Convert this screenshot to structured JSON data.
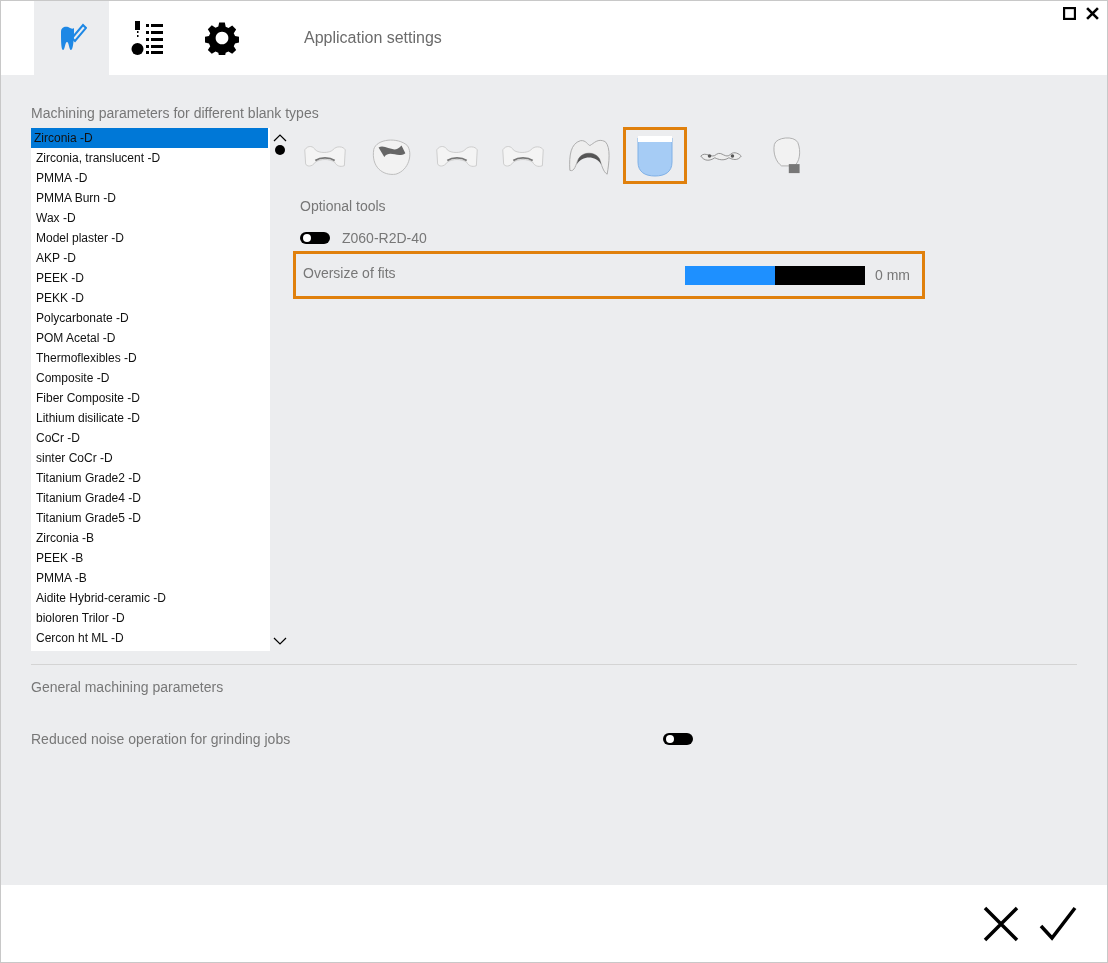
{
  "header": {
    "tabs": [
      {
        "kind": "tooth",
        "selected": true
      },
      {
        "kind": "toolpath",
        "selected": false
      },
      {
        "kind": "gear",
        "selected": false
      }
    ],
    "title": "Application settings"
  },
  "blank_section": {
    "heading": "Machining parameters for different blank types",
    "blank_types": [
      {
        "label": "Zirconia -D",
        "selected": true
      },
      {
        "label": "Zirconia, translucent -D",
        "selected": false
      },
      {
        "label": "PMMA -D",
        "selected": false
      },
      {
        "label": "PMMA Burn -D",
        "selected": false
      },
      {
        "label": "Wax -D",
        "selected": false
      },
      {
        "label": "Model plaster -D",
        "selected": false
      },
      {
        "label": "AKP -D",
        "selected": false
      },
      {
        "label": "PEEK -D",
        "selected": false
      },
      {
        "label": "PEKK -D",
        "selected": false
      },
      {
        "label": "Polycarbonate -D",
        "selected": false
      },
      {
        "label": "POM Acetal -D",
        "selected": false
      },
      {
        "label": "Thermoflexibles -D",
        "selected": false
      },
      {
        "label": "Composite -D",
        "selected": false
      },
      {
        "label": "Fiber Composite -D",
        "selected": false
      },
      {
        "label": "Lithium disilicate -D",
        "selected": false
      },
      {
        "label": "CoCr -D",
        "selected": false
      },
      {
        "label": "sinter CoCr -D",
        "selected": false
      },
      {
        "label": "Titanium Grade2 -D",
        "selected": false
      },
      {
        "label": "Titanium Grade4 -D",
        "selected": false
      },
      {
        "label": "Titanium Grade5 -D",
        "selected": false
      },
      {
        "label": "Zirconia -B",
        "selected": false
      },
      {
        "label": "PEEK -B",
        "selected": false
      },
      {
        "label": "PMMA -B",
        "selected": false
      },
      {
        "label": "Aidite Hybrid-ceramic -D",
        "selected": false
      },
      {
        "label": "bioloren Trilor -D",
        "selected": false
      },
      {
        "label": "Cercon ht ML -D",
        "selected": false
      }
    ],
    "restoration_types": [
      {
        "kind": "bridge",
        "selected": false
      },
      {
        "kind": "inlay",
        "selected": false
      },
      {
        "kind": "bridge",
        "selected": false
      },
      {
        "kind": "bridge",
        "selected": false
      },
      {
        "kind": "crown",
        "selected": false
      },
      {
        "kind": "veneer",
        "selected": true
      },
      {
        "kind": "bar",
        "selected": false
      },
      {
        "kind": "abutment",
        "selected": false
      }
    ],
    "optional_tools_heading": "Optional tools",
    "tools": [
      {
        "name": "Z060-R2D-40",
        "on": false
      }
    ],
    "parameters": [
      {
        "label": "Oversize of fits",
        "level": 0.5,
        "reading": "0 mm",
        "highlighted": true
      }
    ]
  },
  "general_section": {
    "heading": "General machining parameters",
    "settings": [
      {
        "label": "Reduced noise operation for grinding jobs",
        "on": false
      }
    ]
  }
}
